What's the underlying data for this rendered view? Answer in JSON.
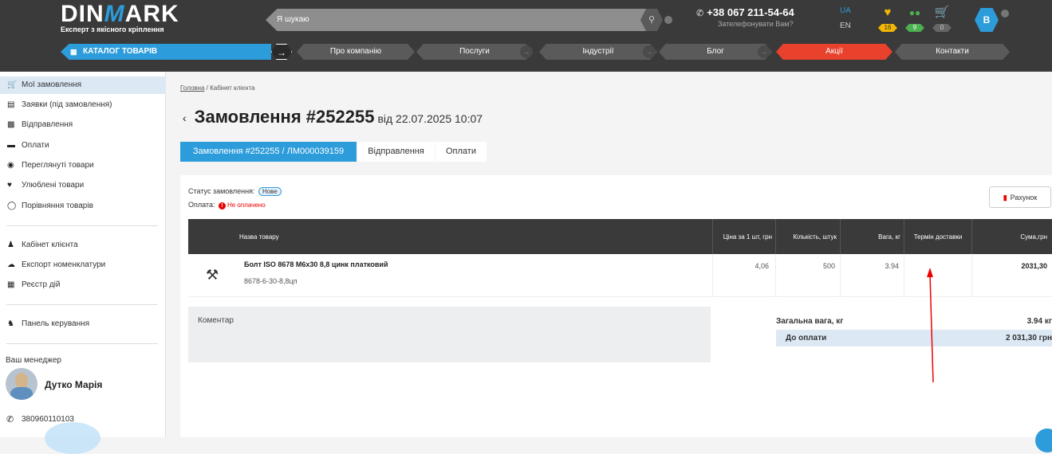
{
  "header": {
    "brand_a": "DIN",
    "brand_b": "M",
    "brand_c": "ARK",
    "tagline": "Експерт з якісного кріплення",
    "search_placeholder": "Я шукаю",
    "phone": "+38 067 211-54-64",
    "callback": "Зателефонувати Вам?",
    "lang_ua": "UA",
    "lang_en": "EN",
    "favorites_count": "16",
    "compare_count": "9",
    "cart_count": "0",
    "user_initial": "B",
    "accent": "#2d9cdb"
  },
  "nav": {
    "catalog": "КАТАЛОГ ТОВАРІВ",
    "items": [
      "Про компанію",
      "Послуги",
      "Індустрії",
      "Блог",
      "Акції",
      "Контакти"
    ],
    "highlight_color": "#e8412c"
  },
  "sidebar": {
    "items": [
      {
        "label": "Мої замовлення",
        "icon": "cart-icon"
      },
      {
        "label": "Заявки (під замовлення)",
        "icon": "list-icon"
      },
      {
        "label": "Відправлення",
        "icon": "truck-icon"
      },
      {
        "label": "Оплати",
        "icon": "card-icon"
      },
      {
        "label": "Переглянуті товари",
        "icon": "eye-icon"
      },
      {
        "label": "Улюблені товари",
        "icon": "heart-icon"
      },
      {
        "label": "Порівняння товарів",
        "icon": "compare-icon"
      },
      {
        "label": "Кабінет клієнта",
        "icon": "user-icon"
      },
      {
        "label": "Експорт номенклатури",
        "icon": "cloud-icon"
      },
      {
        "label": "Реєстр дій",
        "icon": "register-icon"
      },
      {
        "label": "Панель керування",
        "icon": "admin-icon"
      }
    ],
    "manager_label": "Ваш менеджер",
    "manager_name": "Дутко Марія",
    "manager_phone": "380960110103"
  },
  "main": {
    "breadcrumb_home": "Головна",
    "breadcrumb_current": "Кабінет клієнта",
    "title": "Замовлення #252255",
    "title_date": "від 22.07.2025 10:07",
    "tabs": [
      "Замовлення #252255 / ЛМ000039159",
      "Відправлення",
      "Оплати"
    ],
    "status_label": "Статус замовлення:",
    "status_value": "Нове",
    "payment_label": "Оплата:",
    "payment_value": "Не оплачено",
    "invoice_button": "Рахунок",
    "table": {
      "headers": [
        "Назва товару",
        "Ціна за 1 шт, грн",
        "Кількість, штук",
        "Вага, кг",
        "Термін доставки",
        "Сума,грн"
      ],
      "rows": [
        {
          "name": "Болт ISO 8678 M6x30 8,8 цинк платковий",
          "code": "8678-6-30-8,8цп",
          "price": "4,06",
          "qty": "500",
          "weight": "3.94",
          "delivery": "",
          "sum": "2031,30"
        }
      ]
    },
    "comment_label": "Коментар",
    "total_weight_label": "Загальна вага, кг",
    "total_weight_value": "3.94 кг",
    "due_label": "До оплати",
    "due_value": "2 031,30 грн"
  }
}
